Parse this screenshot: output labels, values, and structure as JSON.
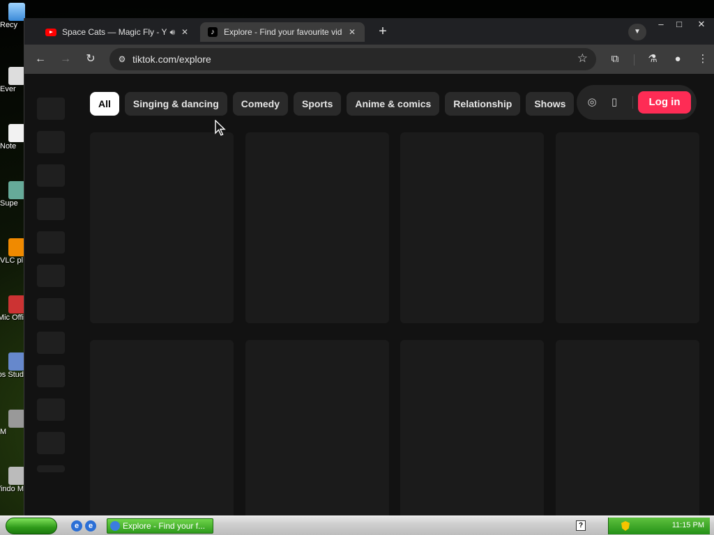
{
  "desktop": {
    "icons": [
      {
        "label": "Recy",
        "icon": "recycle-bin-icon"
      },
      {
        "label": "Ever",
        "icon": "app-icon"
      },
      {
        "label": "Note",
        "icon": "notepad-icon"
      },
      {
        "label": "Supe",
        "icon": "app-icon"
      },
      {
        "label": "VLC pl",
        "icon": "vlc-icon"
      },
      {
        "label": "Mic Offi",
        "icon": "office-icon"
      },
      {
        "label": "Micros Stud",
        "icon": "studio-icon"
      },
      {
        "label": "M",
        "icon": "app-icon"
      },
      {
        "label": "Windo M",
        "icon": "windows-media-icon"
      }
    ]
  },
  "browser": {
    "tabs": [
      {
        "title": "Space Cats — Magic Fly - YouT",
        "icon": "youtube-icon",
        "audible": true,
        "active": false
      },
      {
        "title": "Explore - Find your favourite video",
        "icon": "tiktok-icon",
        "active": false
      }
    ],
    "active_tab_index": 1,
    "new_tab_label": "+",
    "url": "tiktok.com/explore"
  },
  "page": {
    "categories": [
      "All",
      "Singing & dancing",
      "Comedy",
      "Sports",
      "Anime & comics",
      "Relationship",
      "Shows"
    ],
    "selected_category": "All",
    "login_label": "Log in",
    "accent_color": "#fe2c55"
  },
  "taskbar": {
    "task_label": "Explore - Find your f...",
    "clock": "11:15 PM"
  }
}
